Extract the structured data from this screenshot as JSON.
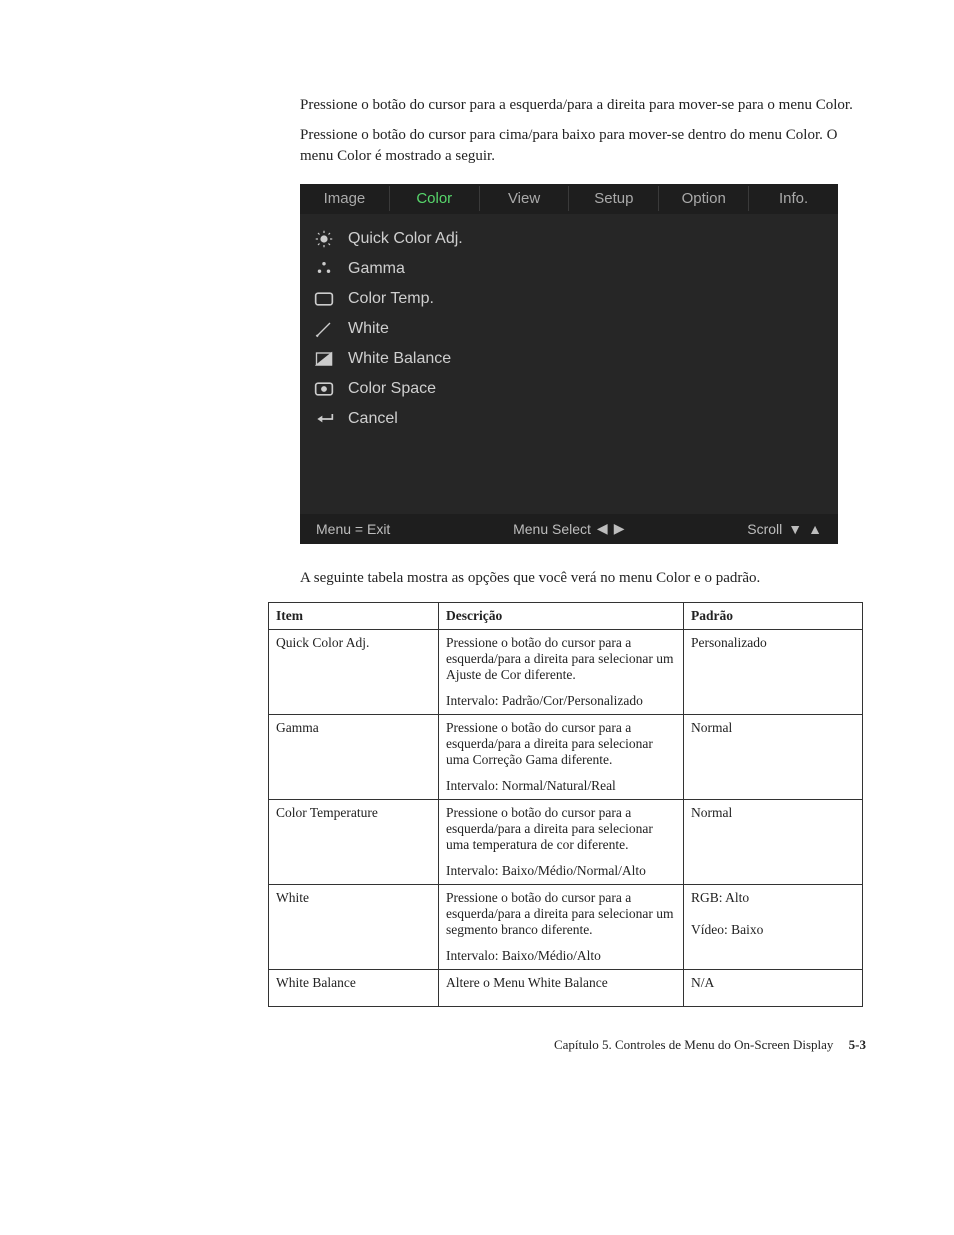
{
  "para1": "Pressione o botão do cursor para a esquerda/para a direita para mover-se para o menu Color.",
  "para2": "Pressione o botão do cursor para cima/para baixo para mover-se dentro do menu Color. O menu Color é mostrado a seguir.",
  "osd": {
    "tabs": [
      "Image",
      "Color",
      "View",
      "Setup",
      "Option",
      "Info."
    ],
    "active_tab_index": 1,
    "items": [
      {
        "icon": "sun",
        "label": "Quick Color Adj."
      },
      {
        "icon": "dots",
        "label": "Gamma"
      },
      {
        "icon": "frame",
        "label": "Color Temp."
      },
      {
        "icon": "brush",
        "label": "White"
      },
      {
        "icon": "contrast",
        "label": "White Balance"
      },
      {
        "icon": "ring",
        "label": "Color Space"
      },
      {
        "icon": "return",
        "label": "Cancel"
      }
    ],
    "footer": {
      "left": "Menu = Exit",
      "mid": "Menu Select",
      "right": "Scroll"
    }
  },
  "table_intro": "A seguinte tabela mostra as opções que você verá no menu Color e o padrão.",
  "table": {
    "headers": [
      "Item",
      "Descrição",
      "Padrão"
    ],
    "rows": [
      {
        "item": "Quick Color Adj.",
        "desc_main": "Pressione o botão do cursor para a esquerda/para a direita para selecionar um Ajuste de Cor diferente.",
        "desc_range": "Intervalo: Padrão/Cor/Personalizado",
        "default": "Personalizado"
      },
      {
        "item": "Gamma",
        "desc_main": "Pressione o botão do cursor para a esquerda/para a direita para selecionar uma Correção Gama diferente.",
        "desc_range": "Intervalo: Normal/Natural/Real",
        "default": "Normal"
      },
      {
        "item": "Color Temperature",
        "desc_main": "Pressione o botão do cursor para a esquerda/para a direita para selecionar uma temperatura de cor diferente.",
        "desc_range": "Intervalo: Baixo/Médio/Normal/Alto",
        "default": "Normal"
      },
      {
        "item": "White",
        "desc_main": "Pressione o botão do cursor para a esquerda/para a direita para selecionar um segmento branco diferente.",
        "desc_range": "Intervalo: Baixo/Médio/Alto",
        "default": "RGB: Alto\n\nVídeo: Baixo"
      },
      {
        "item": "White Balance",
        "desc_main": "Altere o Menu White Balance",
        "desc_range": "",
        "default": "N/A"
      }
    ]
  },
  "footer": {
    "chapter": "Capítulo 5. Controles de Menu do On-Screen Display",
    "pagenum": "5-3"
  }
}
